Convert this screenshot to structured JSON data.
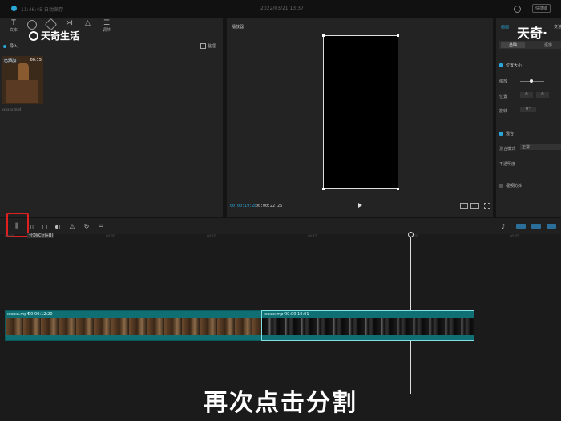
{
  "titlebar": {
    "left_text": "11:46:45 自动保存",
    "center_text": "2022/03/21 13:37",
    "right_button": "快捷键"
  },
  "watermark": {
    "left": "天奇生活",
    "right": "天奇·"
  },
  "media_panel": {
    "tabs": [
      {
        "icon": "text-T-icon",
        "label": "文本"
      },
      {
        "icon": "audio-icon",
        "label": ""
      },
      {
        "icon": "sticker-icon",
        "label": ""
      },
      {
        "icon": "transition-icon",
        "label": ""
      },
      {
        "icon": "filter-icon",
        "label": ""
      },
      {
        "icon": "adjust-icon",
        "label": "调节"
      }
    ],
    "import_label": "导入",
    "view_label": "整理",
    "thumb_badge": "已添加",
    "thumb_duration": "00:15",
    "thumb_name": "xxxxxx.mp4"
  },
  "preview": {
    "title": "播放器",
    "current_time": "00:00:19:28",
    "total_time": "00:00:22:26"
  },
  "props": {
    "tabs": [
      "画面",
      "变速"
    ],
    "subtabs": [
      "基础",
      "抠像"
    ],
    "section_title": "位置大小",
    "rows": [
      {
        "label": "缩放",
        "value": ""
      },
      {
        "label": "位置",
        "x": "0",
        "y": "0"
      },
      {
        "label": "旋转",
        "value": "0°"
      }
    ],
    "blend_title": "混合",
    "blend_mode_label": "混合模式",
    "blend_mode_value": "正常",
    "opacity_label": "不透明度",
    "stabilize_label": "视频防抖"
  },
  "timeline": {
    "split_tooltip": "分割(Ctrl+B)",
    "ruler_ticks": [
      "00:00",
      "00:05",
      "00:10",
      "00:15",
      "00:20",
      "00:25"
    ],
    "clip_a": {
      "name": "xxxxx.mp4",
      "duration": "00:00:12:20"
    },
    "clip_b": {
      "name": "xxxxx.mp4",
      "duration": "00:00:10:01"
    }
  },
  "subtitle": "再次点击分割",
  "highlight_color": "#e02020",
  "accent_color": "#2aa7d8"
}
